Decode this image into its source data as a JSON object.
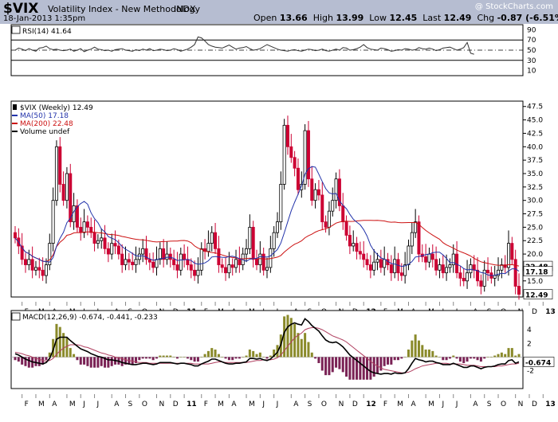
{
  "header": {
    "symbol": "$VIX",
    "name": "Volatility Index - New Methodology",
    "exchange": "INDX",
    "watermark": "@ StockCharts.com",
    "date": "18-Jan-2013 1:35pm",
    "open_label": "Open",
    "open": "13.66",
    "high_label": "High",
    "high": "13.99",
    "low_label": "Low",
    "low": "12.45",
    "last_label": "Last",
    "last": "12.49",
    "chg_label": "Chg",
    "chg": "-0.87 (-6.51%)",
    "chg_arrow": "▼"
  },
  "colors": {
    "header_bg": "#b6bdd1",
    "up": "#000000",
    "down": "#cc0033",
    "ma50": "#2233aa",
    "ma200": "#cc1111",
    "hist": "#8a8a2a",
    "hist_neg": "#7a2255"
  },
  "chart_data": [
    {
      "type": "line",
      "panel": "rsi",
      "legend": "RSI(14) 41.64",
      "y_ticks": [
        "90",
        "70",
        "50",
        "30",
        "10"
      ],
      "ylim": [
        0,
        100
      ],
      "levels": [
        70,
        30
      ],
      "midline": 50,
      "series": [
        {
          "values": [
            50,
            54,
            52,
            49,
            53,
            50,
            48,
            54,
            55,
            58,
            53,
            51,
            52,
            50,
            49,
            50,
            52,
            48,
            50,
            53,
            47,
            50,
            52,
            56,
            52,
            51,
            49,
            50,
            48,
            51,
            52,
            53,
            50,
            49,
            48,
            51,
            49,
            52,
            50,
            53,
            49,
            50,
            52,
            51,
            49,
            50,
            53,
            51,
            48,
            50,
            52,
            56,
            61,
            76,
            74,
            68,
            61,
            58,
            56,
            55,
            54,
            57,
            60,
            56,
            52,
            54,
            55,
            57,
            53,
            50,
            51,
            53,
            57,
            61,
            58,
            55,
            52,
            50,
            49,
            48,
            50,
            51,
            49,
            48,
            50,
            52,
            51,
            49,
            50,
            52,
            49,
            48,
            50,
            52,
            50,
            55,
            54,
            50,
            51,
            53,
            56,
            61,
            55,
            52,
            51,
            50,
            54,
            53,
            51,
            48,
            49,
            51,
            50,
            53,
            52,
            50,
            51,
            55,
            53,
            52,
            54,
            52,
            49,
            51,
            54,
            55,
            56,
            53,
            50,
            52,
            55,
            65,
            44,
            42
          ]
        }
      ]
    },
    {
      "type": "candlestick",
      "panel": "price",
      "legend": [
        "$VIX (Weekly) 12.49",
        "MA(50) 17.18",
        "MA(200) 22.48",
        "Volume undef"
      ],
      "y_ticks": [
        "47.5",
        "45.0",
        "42.5",
        "40.0",
        "37.5",
        "35.0",
        "32.5",
        "30.0",
        "27.5",
        "25.0",
        "22.5",
        "20.0",
        "17.5",
        "15.0"
      ],
      "ylim": [
        12,
        48.5
      ],
      "last_price_label": "12.49",
      "ma200_label": "22.48",
      "ma50_label": "17.18",
      "close": [
        23,
        21.5,
        19,
        18,
        19,
        17,
        17.5,
        17,
        16,
        18,
        22,
        30,
        40,
        33,
        30,
        35,
        26,
        29,
        25,
        24,
        26,
        25,
        24,
        22,
        22.5,
        23,
        21,
        20,
        22,
        21.5,
        20,
        18,
        19,
        18.5,
        18,
        19,
        20,
        21,
        19,
        18.5,
        17.5,
        19,
        21,
        19,
        20,
        19,
        18,
        17,
        20,
        19,
        18,
        17,
        16,
        17,
        21,
        20.5,
        22,
        24,
        21,
        18,
        17.5,
        16.5,
        18,
        17.5,
        19,
        18,
        20,
        21,
        25,
        19,
        18,
        20,
        17,
        17.5,
        21,
        24,
        26,
        33,
        44,
        40,
        38,
        36,
        32,
        33,
        43,
        34,
        30,
        32,
        31,
        26,
        25,
        28,
        30,
        34,
        29,
        26,
        23.5,
        21.5,
        22,
        20.5,
        20,
        19,
        18,
        17,
        18.5,
        19,
        17.5,
        19,
        18,
        16.5,
        19,
        16.5,
        16,
        18,
        21.5,
        24,
        26,
        20,
        19.5,
        18.5,
        20,
        19,
        17,
        18,
        16.5,
        17.5,
        18,
        20,
        16.5,
        15.5,
        15,
        16.5,
        18,
        17,
        15,
        14,
        17,
        16.5,
        15.5,
        16,
        17,
        18,
        17.5,
        22,
        19,
        14,
        12.5
      ]
    },
    {
      "type": "line",
      "panel": "macd",
      "legend": "MACD(12,26,9) -0.674, -0.441, -0.233",
      "y_ticks": [
        "4",
        "2",
        "-2"
      ],
      "ylim": [
        -4.6,
        6.8
      ],
      "last_macd_label": "-0.674",
      "series": [
        {
          "values": [
            0.5,
            0.3,
            0.0,
            -0.3,
            -0.5,
            -0.7,
            -0.8,
            -0.9,
            -1.0,
            -0.8,
            -0.2,
            1.0,
            2.6,
            2.9,
            2.9,
            2.9,
            2.4,
            2.0,
            1.6,
            1.2,
            1.0,
            0.8,
            0.5,
            0.3,
            0.1,
            0.0,
            -0.2,
            -0.4,
            -0.4,
            -0.5,
            -0.6,
            -0.8,
            -0.9,
            -1.0,
            -1.1,
            -1.1,
            -1.0,
            -0.9,
            -0.9,
            -1.0,
            -1.1,
            -1.0,
            -0.8,
            -0.8,
            -0.8,
            -0.8,
            -0.9,
            -1.0,
            -0.9,
            -0.9,
            -1.0,
            -1.1,
            -1.3,
            -1.3,
            -1.0,
            -0.8,
            -0.6,
            -0.3,
            -0.3,
            -0.5,
            -0.7,
            -0.9,
            -1.0,
            -1.0,
            -0.9,
            -0.9,
            -0.8,
            -0.7,
            -0.2,
            -0.2,
            -0.3,
            -0.2,
            -0.4,
            -0.5,
            -0.3,
            0.2,
            0.7,
            1.8,
            3.6,
            4.4,
            4.8,
            5.0,
            4.8,
            4.7,
            5.6,
            5.2,
            4.6,
            4.2,
            3.8,
            3.1,
            2.5,
            2.2,
            2.1,
            2.2,
            1.9,
            1.5,
            0.9,
            0.3,
            -0.1,
            -0.5,
            -0.9,
            -1.3,
            -1.7,
            -2.1,
            -2.3,
            -2.4,
            -2.5,
            -2.4,
            -2.4,
            -2.5,
            -2.3,
            -2.4,
            -2.4,
            -2.3,
            -1.7,
            -0.9,
            -0.2,
            -0.4,
            -0.5,
            -0.7,
            -0.6,
            -0.6,
            -0.8,
            -0.9,
            -1.1,
            -1.1,
            -1.1,
            -0.9,
            -1.1,
            -1.3,
            -1.5,
            -1.5,
            -1.3,
            -1.3,
            -1.5,
            -1.7,
            -1.5,
            -1.4,
            -1.4,
            -1.3,
            -1.1,
            -1.0,
            -1.0,
            -0.5,
            -0.4,
            -0.9,
            -0.7
          ]
        },
        {
          "values": [
            0.7,
            0.6,
            0.5,
            0.3,
            0.2,
            0.0,
            -0.2,
            -0.3,
            -0.5,
            -0.6,
            -0.5,
            -0.2,
            0.4,
            0.9,
            1.3,
            1.6,
            1.8,
            1.8,
            1.8,
            1.7,
            1.5,
            1.4,
            1.2,
            1.0,
            0.8,
            0.6,
            0.5,
            0.3,
            0.2,
            0.0,
            -0.1,
            -0.2,
            -0.4,
            -0.5,
            -0.6,
            -0.7,
            -0.8,
            -0.8,
            -0.8,
            -0.9,
            -0.9,
            -0.9,
            -0.9,
            -0.9,
            -0.9,
            -0.9,
            -0.9,
            -0.9,
            -0.9,
            -0.9,
            -0.9,
            -0.9,
            -1.0,
            -1.0,
            -1.0,
            -1.0,
            -1.0,
            -0.9,
            -0.8,
            -0.7,
            -0.7,
            -0.8,
            -0.8,
            -0.8,
            -0.8,
            -0.8,
            -0.8,
            -0.8,
            -0.7,
            -0.6,
            -0.5,
            -0.5,
            -0.4,
            -0.4,
            -0.4,
            -0.3,
            -0.1,
            0.3,
            0.9,
            1.6,
            2.2,
            2.8,
            3.2,
            3.5,
            4.0,
            4.2,
            4.3,
            4.3,
            4.2,
            4.0,
            3.7,
            3.4,
            3.1,
            2.9,
            2.7,
            2.5,
            2.2,
            1.8,
            1.4,
            1.0,
            0.6,
            0.2,
            -0.2,
            -0.6,
            -1.0,
            -1.3,
            -1.6,
            -1.8,
            -1.9,
            -2.0,
            -2.1,
            -2.2,
            -2.3,
            -2.3,
            -2.2,
            -2.0,
            -1.7,
            -1.5,
            -1.3,
            -1.2,
            -1.1,
            -1.0,
            -0.9,
            -0.9,
            -0.9,
            -0.9,
            -1.0,
            -1.0,
            -1.0,
            -1.0,
            -1.1,
            -1.2,
            -1.2,
            -1.2,
            -1.3,
            -1.4,
            -1.4,
            -1.4,
            -1.4,
            -1.4,
            -1.3,
            -1.3,
            -1.2,
            -1.1,
            -1.0,
            -1.0,
            -0.9
          ]
        }
      ]
    }
  ],
  "x_axis": {
    "labels": [
      {
        "t": "F",
        "w": 2
      },
      {
        "t": "M",
        "w": 6
      },
      {
        "t": "A",
        "w": 10
      },
      {
        "t": "M",
        "w": 15
      },
      {
        "t": "J",
        "w": 19
      },
      {
        "t": "J",
        "w": 23
      },
      {
        "t": "A",
        "w": 28
      },
      {
        "t": "S",
        "w": 32
      },
      {
        "t": "O",
        "w": 36
      },
      {
        "t": "N",
        "w": 41
      },
      {
        "t": "D",
        "w": 45
      },
      {
        "t": "11",
        "w": 49,
        "bold": true
      },
      {
        "t": "F",
        "w": 54
      },
      {
        "t": "M",
        "w": 58
      },
      {
        "t": "A",
        "w": 62
      },
      {
        "t": "M",
        "w": 67
      },
      {
        "t": "J",
        "w": 71
      },
      {
        "t": "J",
        "w": 75
      },
      {
        "t": "A",
        "w": 80
      },
      {
        "t": "S",
        "w": 84
      },
      {
        "t": "O",
        "w": 88
      },
      {
        "t": "N",
        "w": 93
      },
      {
        "t": "D",
        "w": 97
      },
      {
        "t": "12",
        "w": 101,
        "bold": true
      },
      {
        "t": "F",
        "w": 106
      },
      {
        "t": "M",
        "w": 110
      },
      {
        "t": "A",
        "w": 114
      },
      {
        "t": "M",
        "w": 119
      },
      {
        "t": "J",
        "w": 123
      },
      {
        "t": "J",
        "w": 127
      },
      {
        "t": "A",
        "w": 132
      },
      {
        "t": "S",
        "w": 136
      },
      {
        "t": "O",
        "w": 140
      },
      {
        "t": "N",
        "w": 145
      },
      {
        "t": "D",
        "w": 149
      },
      {
        "t": "13",
        "w": 153,
        "bold": true
      }
    ]
  }
}
